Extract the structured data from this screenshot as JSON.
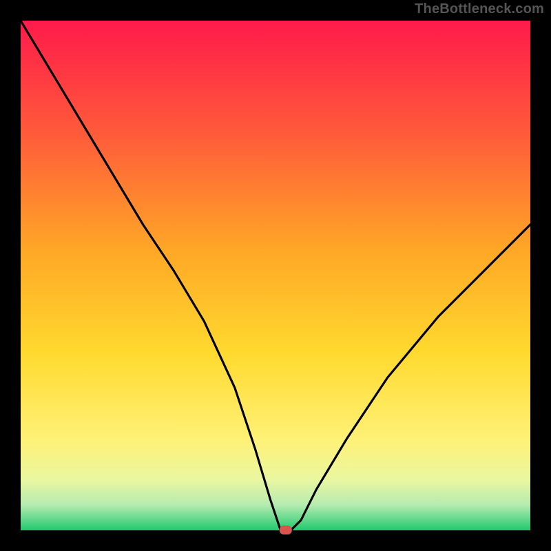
{
  "watermark": "TheBottleneck.com",
  "chart_data": {
    "type": "line",
    "title": "",
    "xlabel": "",
    "ylabel": "",
    "xlim": [
      0,
      100
    ],
    "ylim": [
      0,
      100
    ],
    "grid": false,
    "gradient_stops": [
      {
        "offset": 0.0,
        "color": "#ff1a4b"
      },
      {
        "offset": 0.22,
        "color": "#ff5a3a"
      },
      {
        "offset": 0.45,
        "color": "#ffa726"
      },
      {
        "offset": 0.65,
        "color": "#ffd92e"
      },
      {
        "offset": 0.82,
        "color": "#fff176"
      },
      {
        "offset": 0.9,
        "color": "#eaf7a0"
      },
      {
        "offset": 0.95,
        "color": "#b6ebb0"
      },
      {
        "offset": 1.0,
        "color": "#22c96f"
      }
    ],
    "marker": {
      "x": 52,
      "y": 0,
      "color": "#d8544f"
    },
    "series": [
      {
        "name": "bottleneck-curve",
        "x": [
          0,
          6,
          12,
          18,
          24,
          30,
          36,
          42,
          46,
          49,
          51,
          53,
          55,
          58,
          64,
          72,
          82,
          92,
          100
        ],
        "y": [
          100,
          90,
          80,
          70,
          60,
          51,
          41,
          28,
          16,
          6,
          0,
          0,
          2,
          8,
          18,
          30,
          42,
          52,
          60
        ]
      }
    ]
  }
}
